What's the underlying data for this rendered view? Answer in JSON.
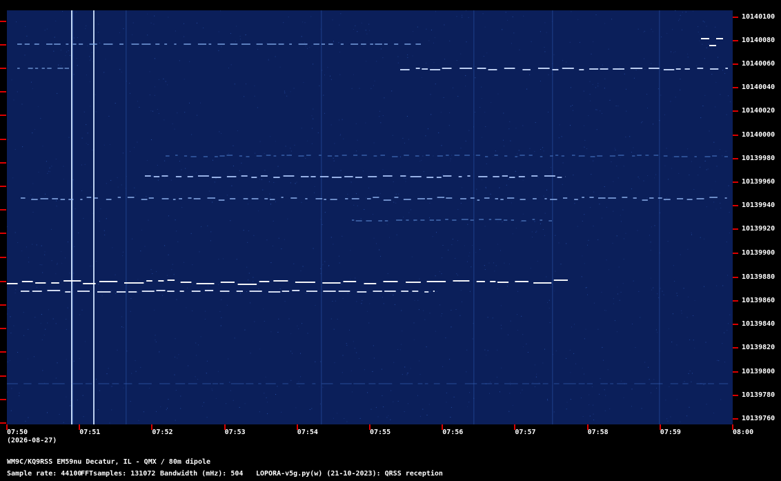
{
  "spectrogram": {
    "colors": {
      "background": "#0b1f5a",
      "signal": "#ffffff",
      "tick": "#dd0000"
    },
    "freq_unit": "Hz",
    "freq_range": [
      10139750,
      10140110
    ],
    "freq_labels": [
      "10140100",
      "10140080",
      "10140060",
      "10140040",
      "10140020",
      "10140000",
      "10139980",
      "10139960",
      "10139940",
      "10139920",
      "10139900",
      "10139880",
      "10139860",
      "10139840",
      "10139820",
      "10139800",
      "10139780",
      "10139760"
    ],
    "time_labels": [
      "07:50",
      "07:51",
      "07:52",
      "07:53",
      "07:54",
      "07:55",
      "07:56",
      "07:57",
      "07:58",
      "07:59",
      "08:00"
    ],
    "date": "(2026-08-27)"
  },
  "footer": {
    "station": "WM9C/KQ9RSS EM59nu Decatur, IL - QMX / 80m dipole",
    "sample_rate": "Sample rate: 44100",
    "fft_samples": "FFTsamples: 131072",
    "bandwidth": "Bandwidth (mHz): 504",
    "software": "LOPORA-v5g.py(w) (21-10-2023): QRSS reception"
  }
}
